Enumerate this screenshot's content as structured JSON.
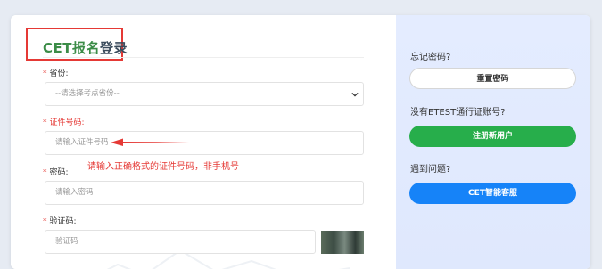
{
  "form": {
    "title_green": "CET报名",
    "title_dark": "登录",
    "province": {
      "label": "省份:",
      "selected": "--请选择考点省份--"
    },
    "id_number": {
      "label": "证件号码:",
      "placeholder": "请输入证件号码",
      "hint": "请输入正确格式的证件号码，非手机号"
    },
    "password": {
      "label": "密码:",
      "placeholder": "请输入密码"
    },
    "captcha": {
      "label": "验证码:",
      "placeholder": "验证码"
    },
    "required_mark": "*"
  },
  "sidebar": {
    "forgot_label": "忘记密码?",
    "reset_button": "重置密码",
    "no_account_label": "没有ETEST通行证账号?",
    "register_button": "注册新用户",
    "problem_label": "遇到问题?",
    "service_button": "CET智能客服"
  },
  "colors": {
    "accent_green": "#27ae4b",
    "accent_blue": "#1683f8",
    "error_red": "#e53935",
    "title_green": "#3b8c47"
  }
}
